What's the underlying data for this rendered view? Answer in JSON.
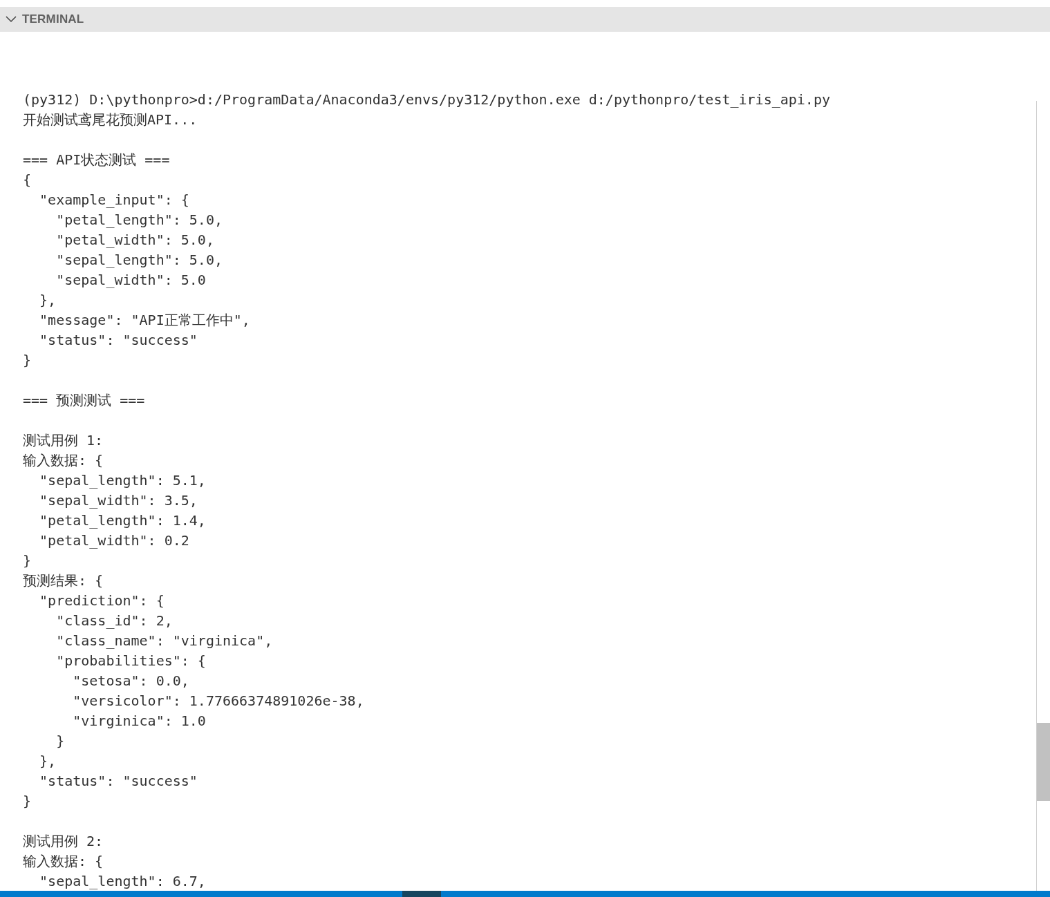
{
  "panel": {
    "title": "TERMINAL",
    "expanded": true
  },
  "blocks": [
    {
      "lines": [
        "(py312) D:\\pythonpro>d:/ProgramData/Anaconda3/envs/py312/python.exe d:/pythonpro/test_iris_api.py",
        "开始测试鸢尾花预测API..."
      ]
    },
    {
      "lines": [
        "=== API状态测试 ===",
        "{",
        "  \"example_input\": {",
        "    \"petal_length\": 5.0,",
        "    \"petal_width\": 5.0,",
        "    \"sepal_length\": 5.0,",
        "    \"sepal_width\": 5.0",
        "  },",
        "  \"message\": \"API正常工作中\",",
        "  \"status\": \"success\"",
        "}"
      ]
    },
    {
      "lines": [
        "=== 预测测试 ==="
      ]
    },
    {
      "lines": [
        "测试用例 1:",
        "输入数据: {",
        "  \"sepal_length\": 5.1,",
        "  \"sepal_width\": 3.5,",
        "  \"petal_length\": 1.4,",
        "  \"petal_width\": 0.2",
        "}",
        "预测结果: {",
        "  \"prediction\": {",
        "    \"class_id\": 2,",
        "    \"class_name\": \"virginica\",",
        "    \"probabilities\": {",
        "      \"setosa\": 0.0,",
        "      \"versicolor\": 1.77666374891026e-38,",
        "      \"virginica\": 1.0",
        "    }",
        "  },",
        "  \"status\": \"success\"",
        "}"
      ]
    },
    {
      "lines": [
        "测试用例 2:",
        "输入数据: {",
        "  \"sepal_length\": 6.7,"
      ]
    }
  ]
}
